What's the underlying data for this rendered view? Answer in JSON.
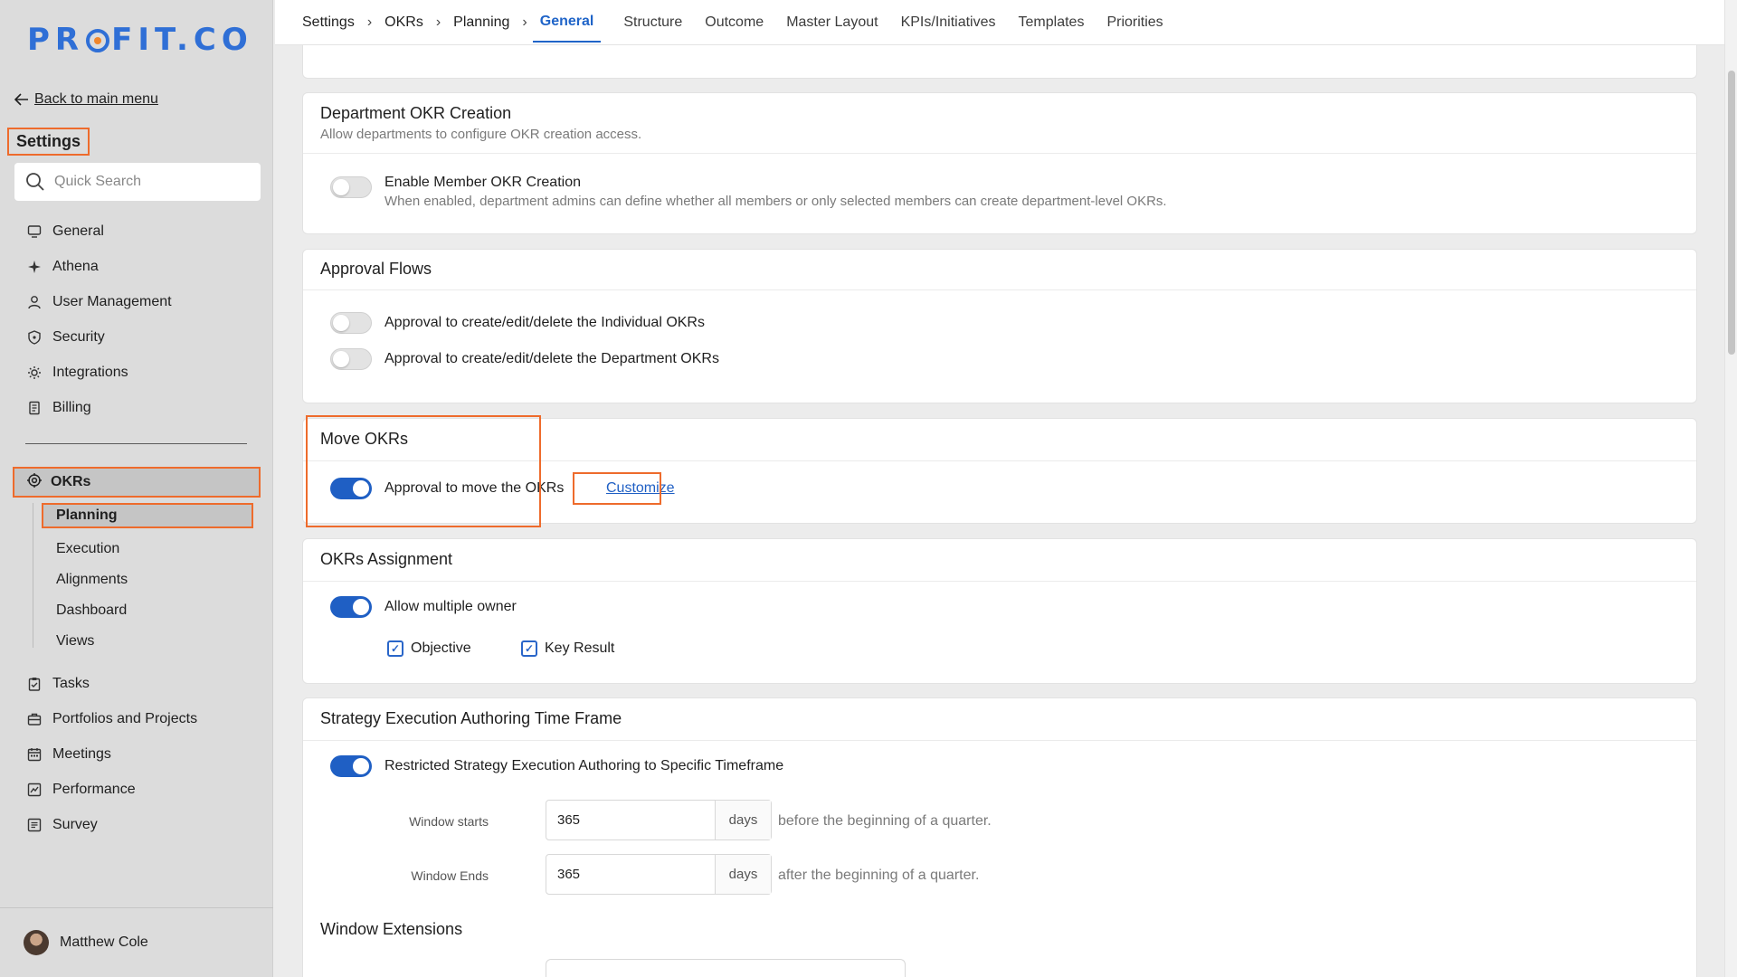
{
  "brand": {
    "logo_text_left": "PR",
    "logo_text_right": "FIT.CO",
    "accent": "#2f6fd6",
    "highlight": "#ee6b2c"
  },
  "sidebar": {
    "back_label": "Back to main menu",
    "section_title": "Settings",
    "search_placeholder": "Quick Search",
    "items": [
      {
        "label": "General",
        "icon": "monitor-icon"
      },
      {
        "label": "Athena",
        "icon": "sparkle-icon"
      },
      {
        "label": "User Management",
        "icon": "user-icon"
      },
      {
        "label": "Security",
        "icon": "shield-icon"
      },
      {
        "label": "Integrations",
        "icon": "gear-icon"
      },
      {
        "label": "Billing",
        "icon": "receipt-icon"
      }
    ],
    "okrs": {
      "label": "OKRs",
      "icon": "target-icon"
    },
    "okrs_sub": [
      "Planning",
      "Execution",
      "Alignments",
      "Dashboard",
      "Views"
    ],
    "items2": [
      {
        "label": "Tasks",
        "icon": "clipboard-check-icon"
      },
      {
        "label": "Portfolios and Projects",
        "icon": "briefcase-icon"
      },
      {
        "label": "Meetings",
        "icon": "calendar-icon"
      },
      {
        "label": "Performance",
        "icon": "chart-line-icon"
      },
      {
        "label": "Survey",
        "icon": "survey-icon"
      }
    ],
    "user_name": "Matthew Cole"
  },
  "topbar": {
    "breadcrumbs": [
      "Settings",
      "OKRs",
      "Planning"
    ],
    "tabs": [
      "General",
      "Structure",
      "Outcome",
      "Master Layout",
      "KPIs/Initiatives",
      "Templates",
      "Priorities"
    ],
    "active_tab": "General"
  },
  "dept": {
    "title": "Department OKR Creation",
    "subtitle": "Allow departments to configure OKR creation access.",
    "toggle_label": "Enable Member OKR Creation",
    "toggle_desc": "When enabled, department admins can define whether all members or only selected members can create department-level OKRs.",
    "toggle_on": false
  },
  "approval": {
    "title": "Approval Flows",
    "items": [
      {
        "label": "Approval to create/edit/delete the Individual OKRs",
        "on": false
      },
      {
        "label": "Approval to create/edit/delete the Department OKRs",
        "on": false
      }
    ]
  },
  "move": {
    "title": "Move OKRs",
    "toggle_label": "Approval to move the OKRs",
    "link_label": "Customize",
    "toggle_on": true
  },
  "assignment": {
    "title": "OKRs Assignment",
    "toggle_label": "Allow multiple owner",
    "toggle_on": true,
    "checks": [
      {
        "label": "Objective",
        "checked": true
      },
      {
        "label": "Key Result",
        "checked": true
      }
    ]
  },
  "strategy": {
    "title": "Strategy Execution Authoring Time Frame",
    "toggle_label": "Restricted Strategy Execution Authoring to Specific Timeframe",
    "toggle_on": true,
    "start_label": "Window starts",
    "start_value": "365",
    "start_unit": "days",
    "start_after": "before the beginning of a quarter.",
    "end_label": "Window Ends",
    "end_value": "365",
    "end_unit": "days",
    "end_after": "after the beginning of a quarter.",
    "extensions_title": "Window Extensions"
  }
}
